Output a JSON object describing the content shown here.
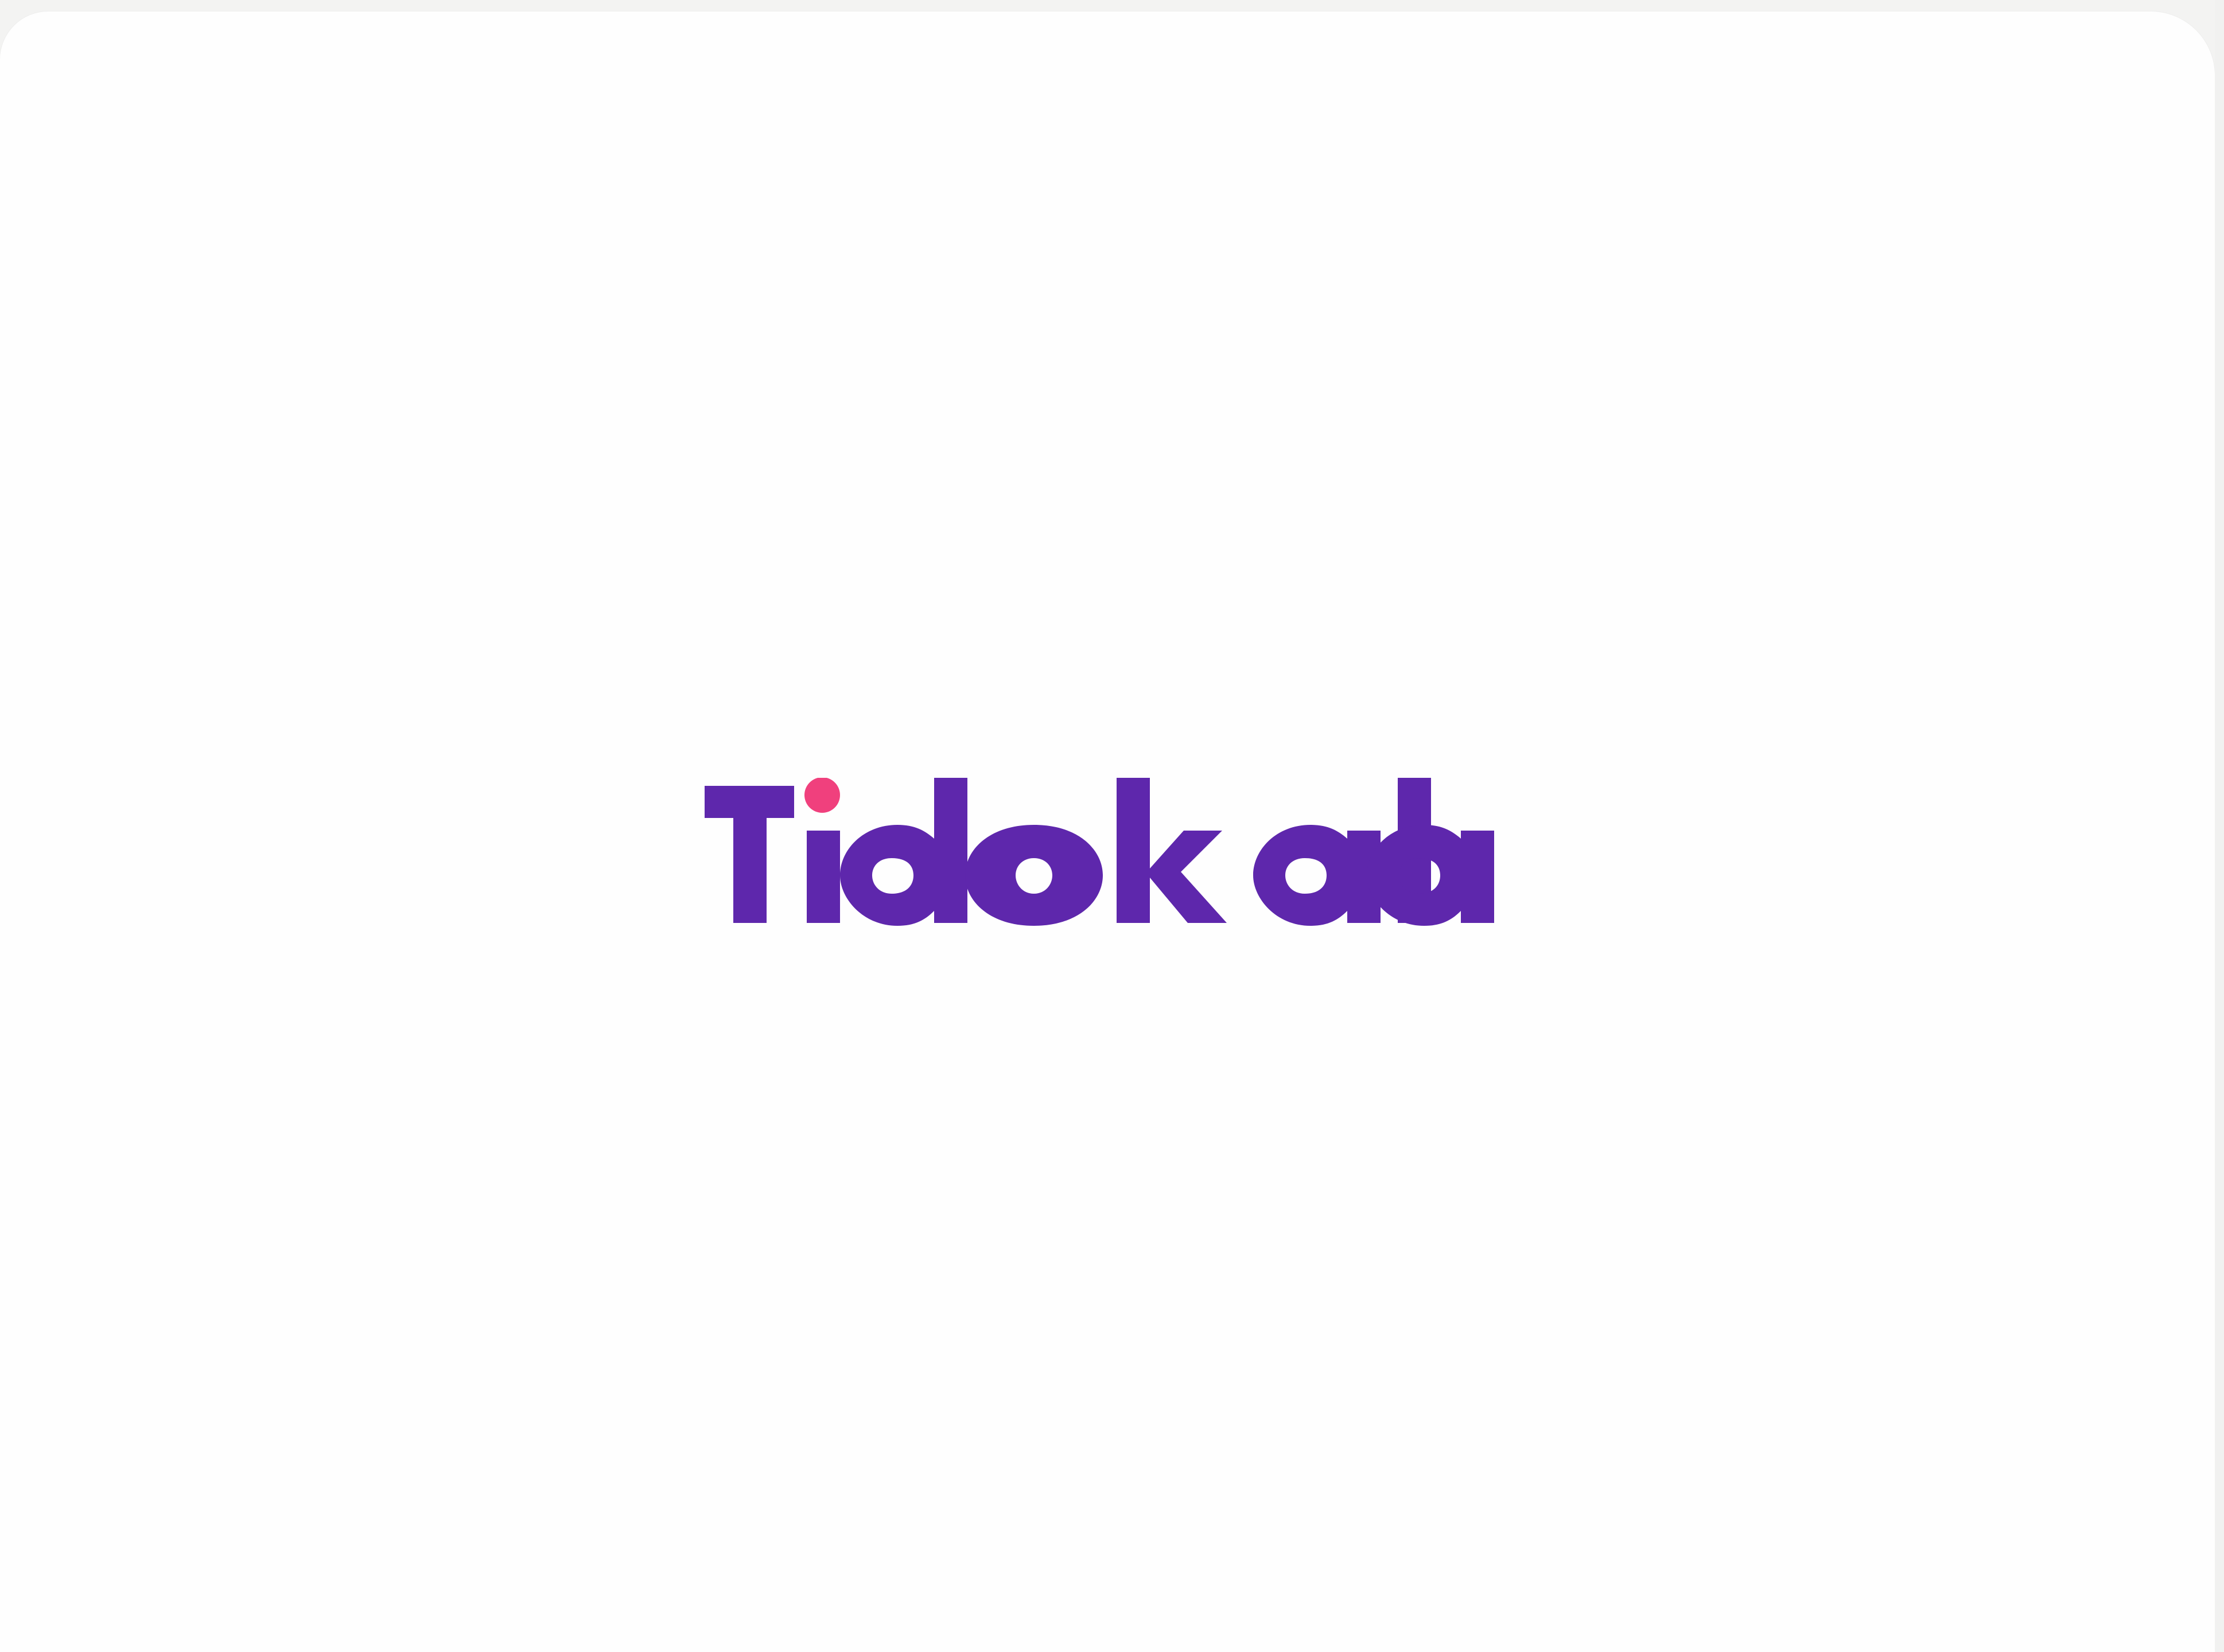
{
  "app": {
    "brand_name": "Tidokala",
    "brand_color": "#5e27ac",
    "accent_dot_color": "#f0407d",
    "background_color": "#fefefe"
  },
  "icons": {
    "logo": "tidokala-wordmark-logo"
  }
}
